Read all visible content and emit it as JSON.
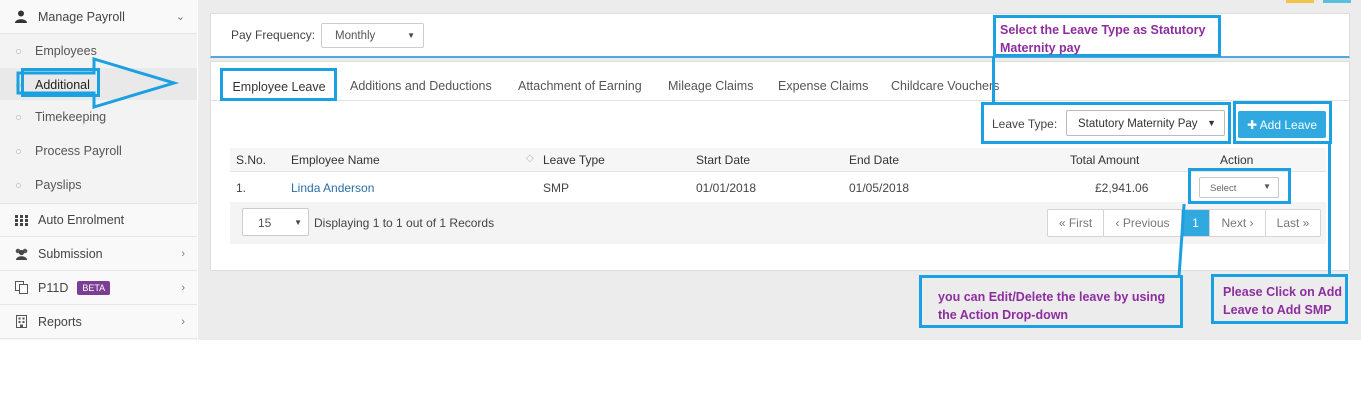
{
  "sidebar": {
    "manage_payroll": "Manage Payroll",
    "sub_items": [
      "Employees",
      "Additional",
      "Timekeeping",
      "Process Payroll",
      "Payslips"
    ],
    "auto_enrolment": "Auto Enrolment",
    "submission": "Submission",
    "p11d": "P11D",
    "beta_badge": "BETA",
    "reports": "Reports"
  },
  "pay_frequency": {
    "label": "Pay Frequency:",
    "value": "Monthly"
  },
  "tabs": [
    "Employee Leave",
    "Additions and Deductions",
    "Attachment of Earning",
    "Mileage Claims",
    "Expense Claims",
    "Childcare Vouchers"
  ],
  "leave_type": {
    "label": "Leave Type:",
    "value": "Statutory Maternity Pay"
  },
  "add_leave_button": "Add Leave",
  "table": {
    "columns": [
      "S.No.",
      "Employee Name",
      "Leave Type",
      "Start Date",
      "End Date",
      "Total Amount",
      "Action"
    ],
    "rows": [
      {
        "sno": "1.",
        "employee": "Linda Anderson",
        "leave_type": "SMP",
        "start": "01/01/2018",
        "end": "01/05/2018",
        "amount": "£2,941.06",
        "action": "Select"
      }
    ]
  },
  "footer": {
    "page_size": "15",
    "displaying": "Displaying 1 to 1 out of 1 Records"
  },
  "pager": {
    "first": "« First",
    "previous": "‹ Previous",
    "current": "1",
    "next": "Next ›",
    "last": "Last »"
  },
  "annotations": {
    "leave_type_note": "Select the Leave Type as Statutory Maternity pay",
    "action_note": "you can Edit/Delete the leave by using the Action Drop-down",
    "add_leave_note": "Please Click on Add Leave to Add SMP"
  },
  "colors": {
    "accent": "#2fa9e0",
    "annotation_box": "#1ba1e2",
    "annotation_text": "#8e2da0",
    "beta": "#7a3f93"
  }
}
